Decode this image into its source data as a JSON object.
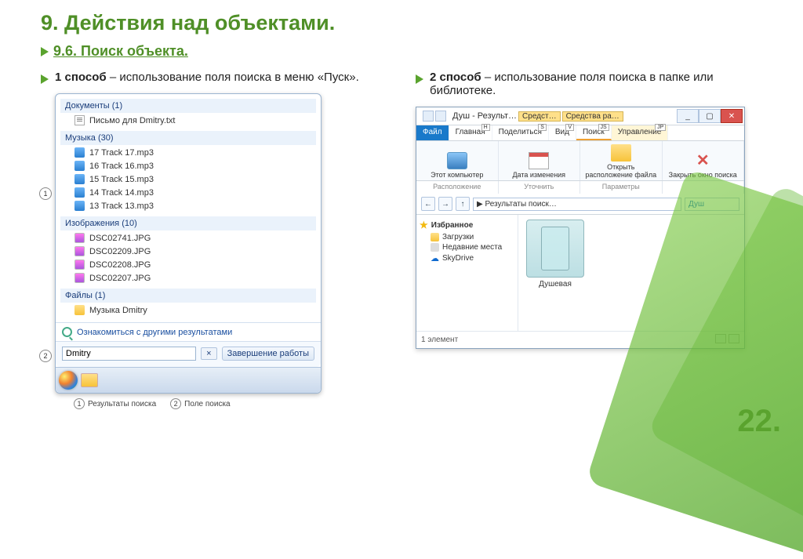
{
  "page_number": "22.",
  "title": "9. Действия над объектами.",
  "subtitle": "9.6. Поиск объекта.",
  "method1": {
    "label": "1 способ",
    "dash": " – ",
    "text": "использование поля поиска в меню «Пуск»."
  },
  "method2": {
    "label": "2 способ",
    "dash": " – ",
    "text": "использование поля поиска в папке или библиотеке."
  },
  "startmenu": {
    "cat_docs": "Документы (1)",
    "doc1": "Письмо для Dmitry.txt",
    "cat_music": "Музыка (30)",
    "mp3": [
      "17 Track 17.mp3",
      "16 Track 16.mp3",
      "15 Track 15.mp3",
      "14 Track 14.mp3",
      "13 Track 13.mp3"
    ],
    "cat_img": "Изображения (10)",
    "jpg": [
      "DSC02741.JPG",
      "DSC02209.JPG",
      "DSC02208.JPG",
      "DSC02207.JPG"
    ],
    "cat_files": "Файлы (1)",
    "file1": "Музыка Dmitry",
    "more": "Ознакомиться с другими результатами",
    "search_value": "Dmitry",
    "clear": "×",
    "shutdown": "Завершение работы",
    "callout1": "Результаты поиска",
    "callout2": "Поле поиска",
    "n1": "1",
    "n2": "2"
  },
  "explorer": {
    "title": "Душ - Результ…",
    "yellow1": "Средст…",
    "yellow2": "Средства ра…",
    "min": "_",
    "max": "▢",
    "close": "✕",
    "tab_file": "Файл",
    "tabs": [
      "Главная",
      "Поделиться",
      "Вид",
      "Поиск",
      "Управление"
    ],
    "hints": [
      "H",
      "S",
      "V",
      "JS",
      "JP"
    ],
    "ribbon": {
      "g1_label": "Этот компьютер",
      "g1_foot": "Расположение",
      "g2_label": "Дата изменения",
      "g2_foot": "Уточнить",
      "g3_label": "Открыть расположение файла",
      "g3_foot": "Параметры",
      "g4_label": "Закрыть окно поиска"
    },
    "nav_back": "←",
    "nav_fwd": "→",
    "nav_up": "↑",
    "address": "▶ Результаты поиск…",
    "search": "Душ",
    "side_fav": "Избранное",
    "side_items": [
      "Загрузки",
      "Недавние места",
      "SkyDrive"
    ],
    "thumb": "Душевая",
    "status": "1 элемент"
  }
}
